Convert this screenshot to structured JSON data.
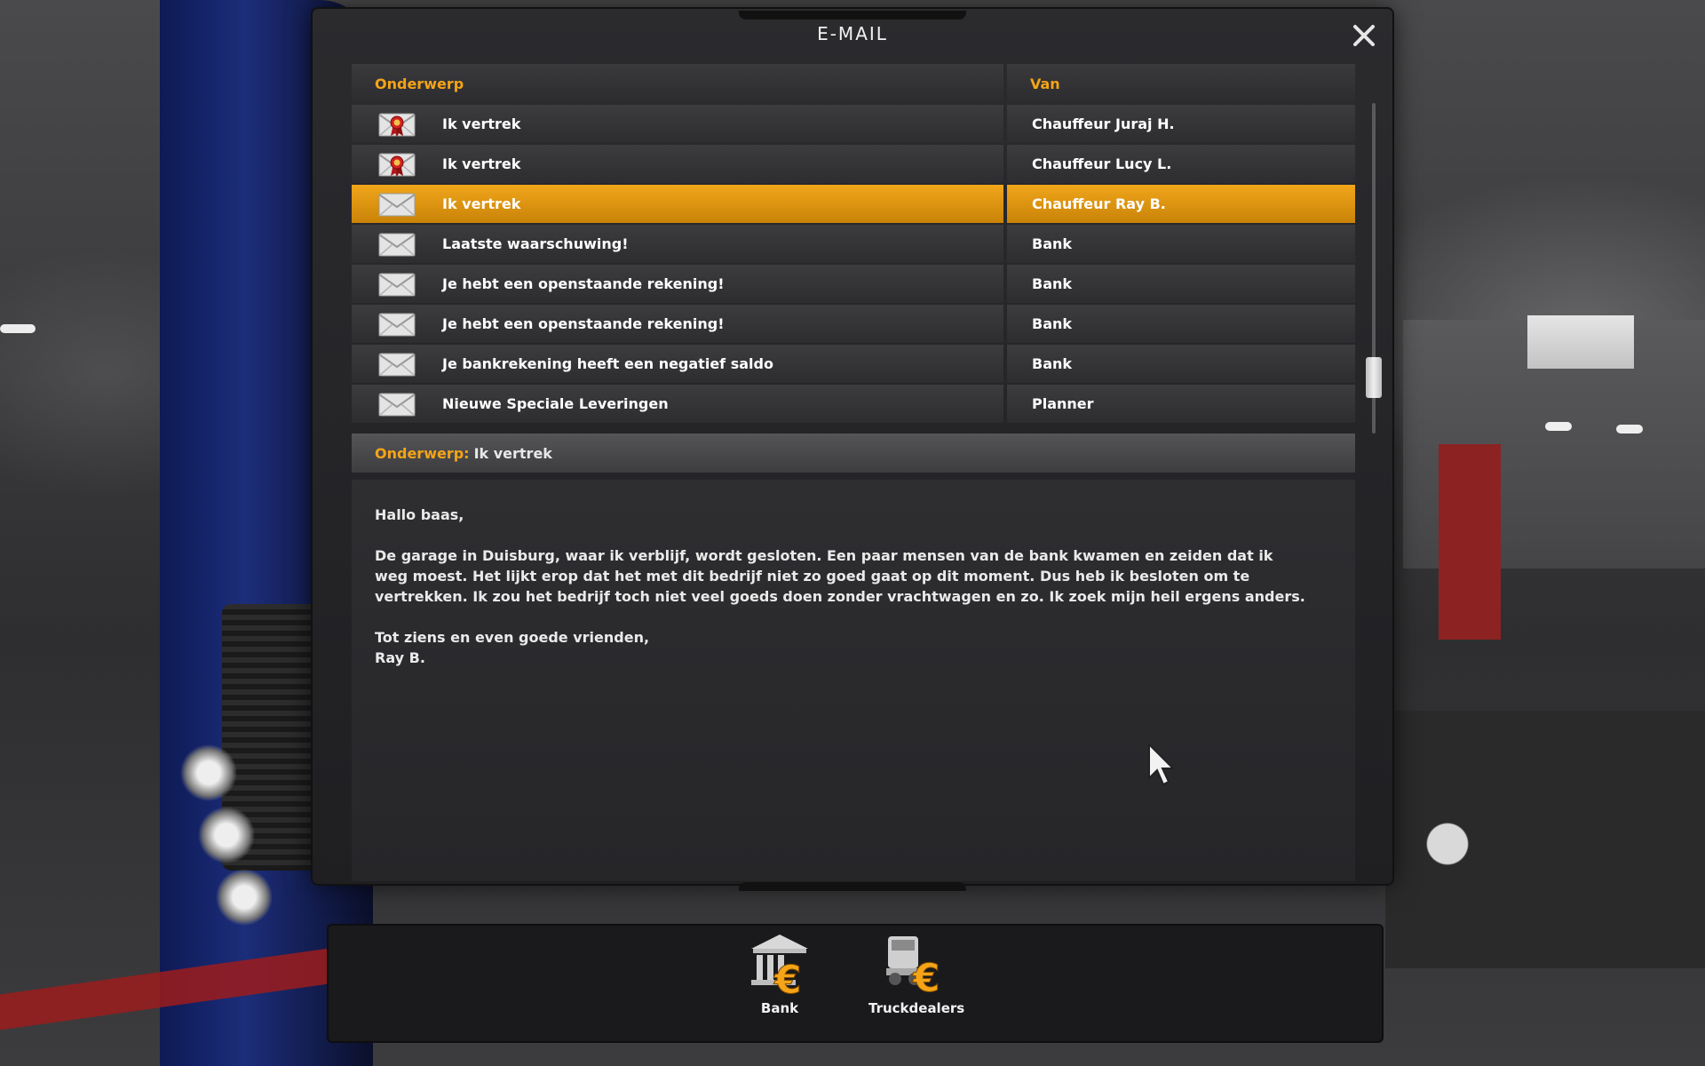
{
  "window": {
    "title": "E-MAIL"
  },
  "columns": {
    "subject": "Onderwerp",
    "from": "Van"
  },
  "mails": [
    {
      "icon": "medal-envelope-icon",
      "subject": "Ik vertrek",
      "from": "Chauffeur Juraj H."
    },
    {
      "icon": "medal-envelope-icon",
      "subject": "Ik vertrek",
      "from": "Chauffeur Lucy L."
    },
    {
      "icon": "envelope-icon",
      "subject": "Ik vertrek",
      "from": "Chauffeur Ray B.",
      "selected": true
    },
    {
      "icon": "envelope-icon",
      "subject": "Laatste waarschuwing!",
      "from": "Bank"
    },
    {
      "icon": "envelope-icon",
      "subject": "Je hebt een openstaande rekening!",
      "from": "Bank"
    },
    {
      "icon": "envelope-icon",
      "subject": "Je hebt een openstaande rekening!",
      "from": "Bank"
    },
    {
      "icon": "envelope-icon",
      "subject": "Je bankrekening heeft een negatief saldo",
      "from": "Bank"
    },
    {
      "icon": "envelope-icon",
      "subject": "Nieuwe Speciale Leveringen",
      "from": "Planner"
    }
  ],
  "selected_mail": {
    "subject_label": "Onderwerp:",
    "subject_value": "Ik vertrek",
    "body": {
      "greeting": "Hallo baas,",
      "paragraph": "De garage in Duisburg, waar ik verblijf, wordt gesloten. Een paar mensen van de bank kwamen en zeiden dat ik weg moest. Het lijkt erop dat het met dit bedrijf niet zo goed gaat op dit moment. Dus heb ik besloten om te vertrekken. Ik zou het bedrijf toch niet veel goeds doen zonder vrachtwagen en zo. Ik zoek mijn heil ergens anders.",
      "closing": "Tot ziens en even goede vrienden,",
      "signature": "Ray B."
    }
  },
  "dock": {
    "bank": {
      "label": "Bank",
      "icon": "bank-euro-icon"
    },
    "truckdealers": {
      "label": "Truckdealers",
      "icon": "truck-euro-icon"
    }
  },
  "colors": {
    "accent": "#f5a417",
    "selected_row": "#e39a12"
  }
}
